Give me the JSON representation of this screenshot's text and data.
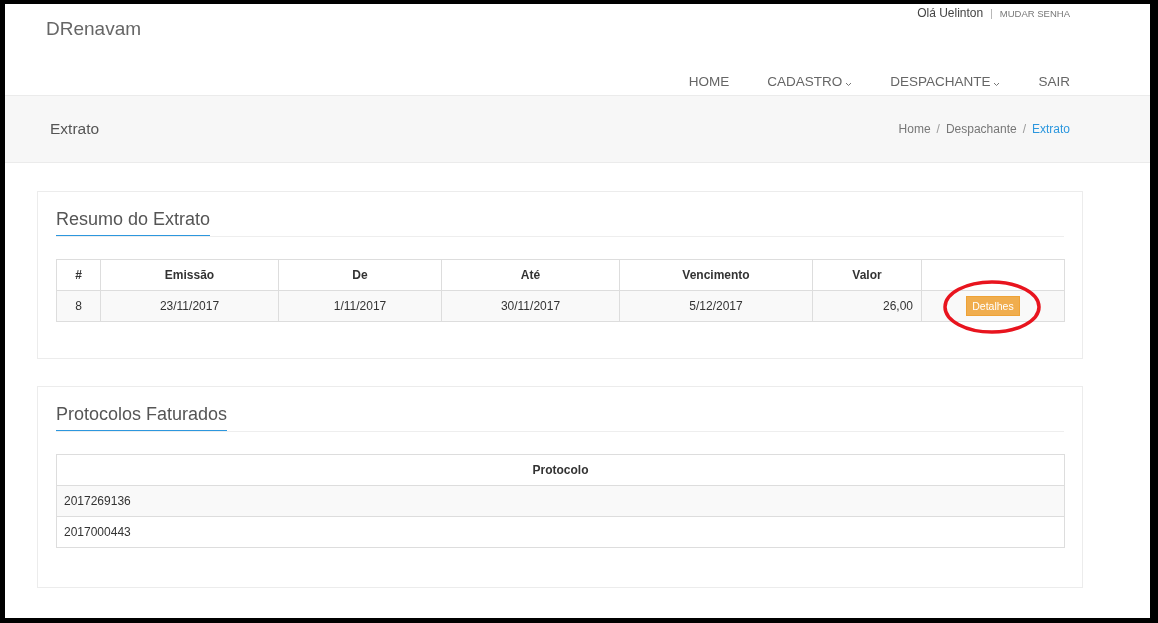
{
  "brand": "DRenavam",
  "user": {
    "greeting": "Olá Uelinton",
    "separator": "|",
    "link": "MUDAR SENHA"
  },
  "nav": [
    {
      "label": "HOME",
      "dropdown": false
    },
    {
      "label": "CADASTRO",
      "dropdown": true
    },
    {
      "label": "DESPACHANTE",
      "dropdown": true
    },
    {
      "label": "SAIR",
      "dropdown": false
    }
  ],
  "page_title": "Extrato",
  "breadcrumb_separator": "/",
  "breadcrumb": [
    {
      "label": "Home",
      "selected": false
    },
    {
      "label": "Despachante",
      "selected": false
    },
    {
      "label": "Extrato",
      "selected": true
    }
  ],
  "summary": {
    "title": "Resumo do Extrato",
    "columns": [
      "#",
      "Emissão",
      "De",
      "Até",
      "Vencimento",
      "Valor",
      ""
    ],
    "rows": [
      {
        "cells": [
          "8",
          "23/11/2017",
          "1/11/2017",
          "30/11/2017",
          "5/12/2017",
          "26,00"
        ],
        "button": "Detalhes",
        "highlighted": true
      }
    ]
  },
  "protocols": {
    "title": "Protocolos Faturados",
    "columns": [
      "Protocolo"
    ],
    "rows": [
      [
        "2017269136"
      ],
      [
        "2017000443"
      ]
    ]
  }
}
